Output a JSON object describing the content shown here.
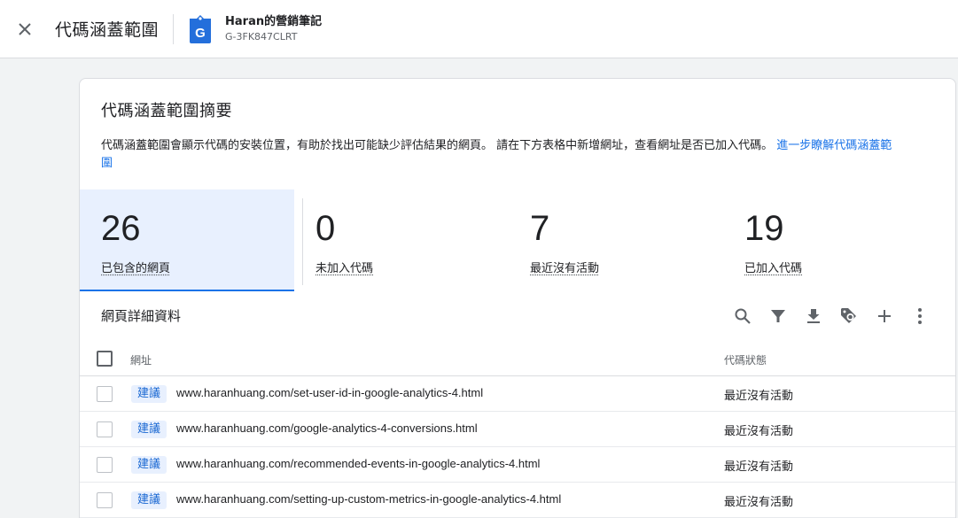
{
  "header": {
    "title": "代碼涵蓋範圍",
    "property_name": "Haran的營銷筆記",
    "property_id": "G-3FK847CLRT"
  },
  "summary": {
    "title": "代碼涵蓋範圍摘要",
    "description": "代碼涵蓋範圍會顯示代碼的安裝位置，有助於找出可能缺少評估結果的網頁。 請在下方表格中新增網址，查看網址是否已加入代碼。",
    "learn_more_link": "進一步瞭解代碼涵蓋範圍"
  },
  "stats": [
    {
      "value": "26",
      "label": "已包含的網頁"
    },
    {
      "value": "0",
      "label": "未加入代碼"
    },
    {
      "value": "7",
      "label": "最近沒有活動"
    },
    {
      "value": "19",
      "label": "已加入代碼"
    }
  ],
  "details": {
    "title": "網頁詳細資料",
    "columns": {
      "url": "網址",
      "status": "代碼狀態"
    },
    "rows": [
      {
        "chip": "建議",
        "url": "www.haranhuang.com/set-user-id-in-google-analytics-4.html",
        "status": "最近沒有活動"
      },
      {
        "chip": "建議",
        "url": "www.haranhuang.com/google-analytics-4-conversions.html",
        "status": "最近沒有活動"
      },
      {
        "chip": "建議",
        "url": "www.haranhuang.com/recommended-events-in-google-analytics-4.html",
        "status": "最近沒有活動"
      },
      {
        "chip": "建議",
        "url": "www.haranhuang.com/setting-up-custom-metrics-in-google-analytics-4.html",
        "status": "最近沒有活動"
      }
    ]
  },
  "icons": {
    "close": "close-icon",
    "property": "tag-manager-icon",
    "search": "search-icon",
    "filter": "filter-icon",
    "download": "download-icon",
    "tag": "tag-icon",
    "add": "add-icon",
    "more": "more-vert-icon"
  },
  "colors": {
    "accent": "#1a73e8",
    "active_bg": "#e8f0fe",
    "chip_text": "#1967d2"
  }
}
